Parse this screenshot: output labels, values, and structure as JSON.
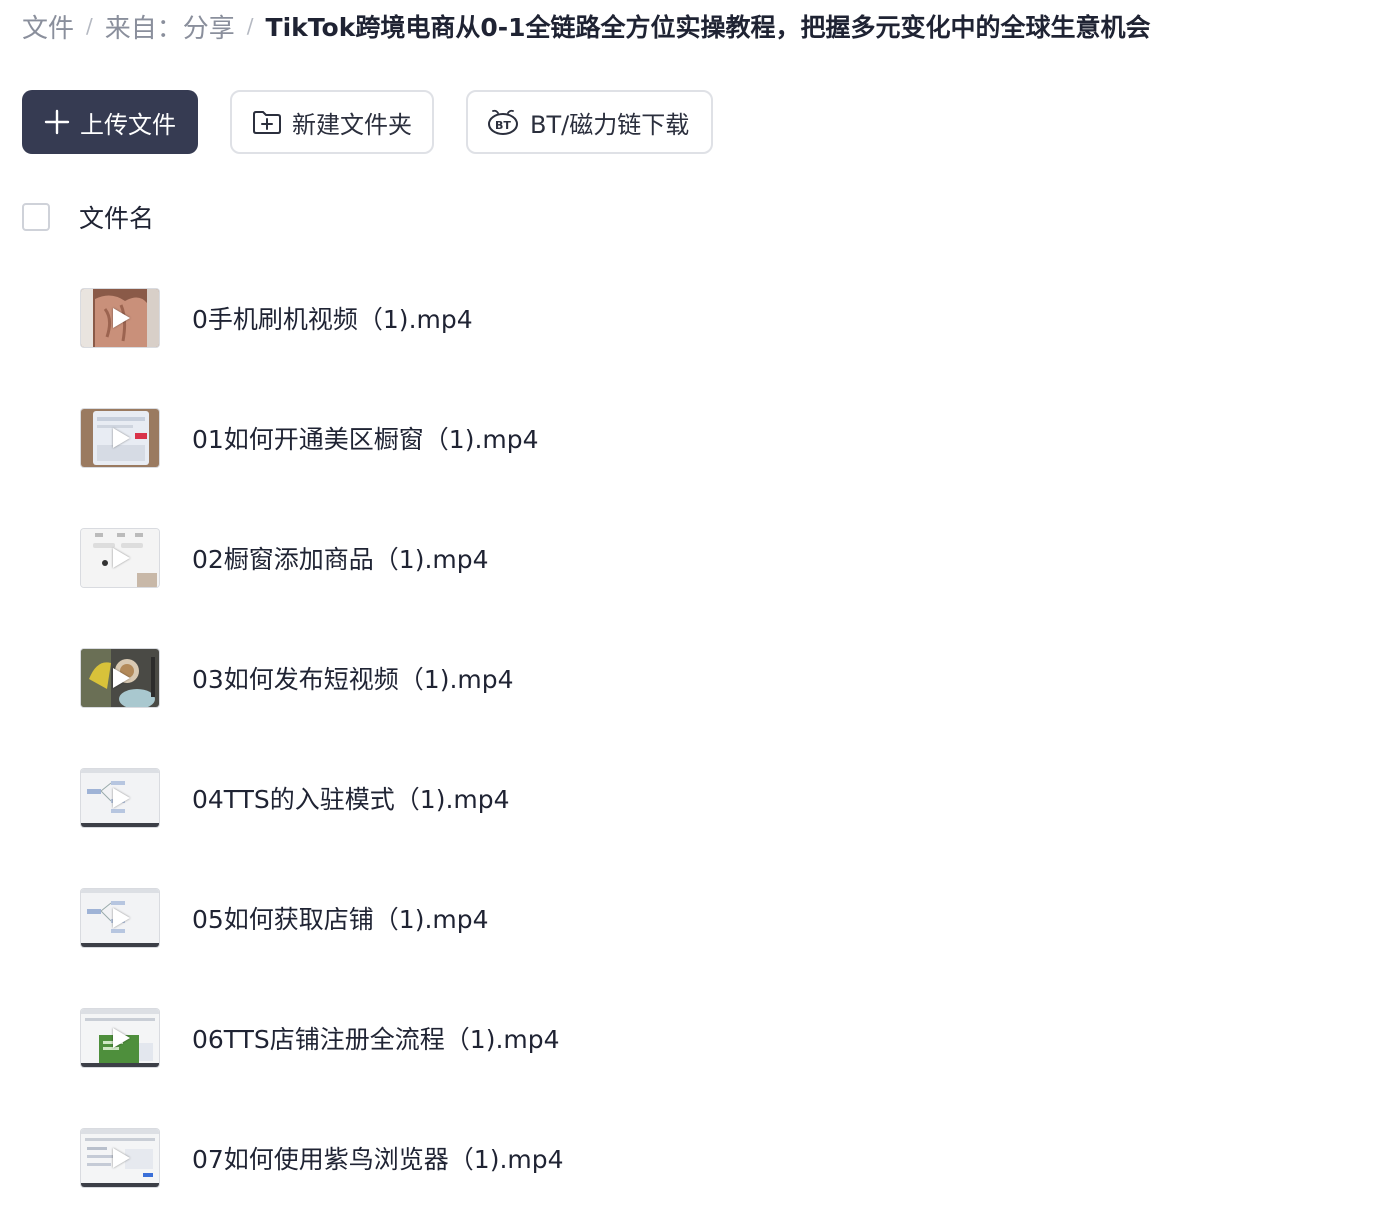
{
  "breadcrumb": {
    "root": "文件",
    "source": "来自：分享",
    "current": "TikTok跨境电商从0-1全链路全方位实操教程，把握多元变化中的全球生意机会",
    "separator": "/"
  },
  "toolbar": {
    "upload_label": "上传文件",
    "new_folder_label": "新建文件夹",
    "bt_download_label": "BT/磁力链下载"
  },
  "table": {
    "column_name": "文件名"
  },
  "files": [
    {
      "name": "0手机刷机视频（1).mp4",
      "thumb": "hand-video"
    },
    {
      "name": "01如何开通美区橱窗（1).mp4",
      "thumb": "phone-video"
    },
    {
      "name": "02橱窗添加商品（1).mp4",
      "thumb": "app-screen"
    },
    {
      "name": "03如何发布短视频（1).mp4",
      "thumb": "food-video"
    },
    {
      "name": "04TTS的入驻模式（1).mp4",
      "thumb": "mindmap"
    },
    {
      "name": "05如何获取店铺（1).mp4",
      "thumb": "mindmap"
    },
    {
      "name": "06TTS店铺注册全流程（1).mp4",
      "thumb": "webpage-green"
    },
    {
      "name": "07如何使用紫鸟浏览器（1).mp4",
      "thumb": "webpage"
    }
  ],
  "colors": {
    "primary_button": "#363b52",
    "text": "#1f2333",
    "muted": "#8a8f9c",
    "border": "#dfe1e6"
  }
}
